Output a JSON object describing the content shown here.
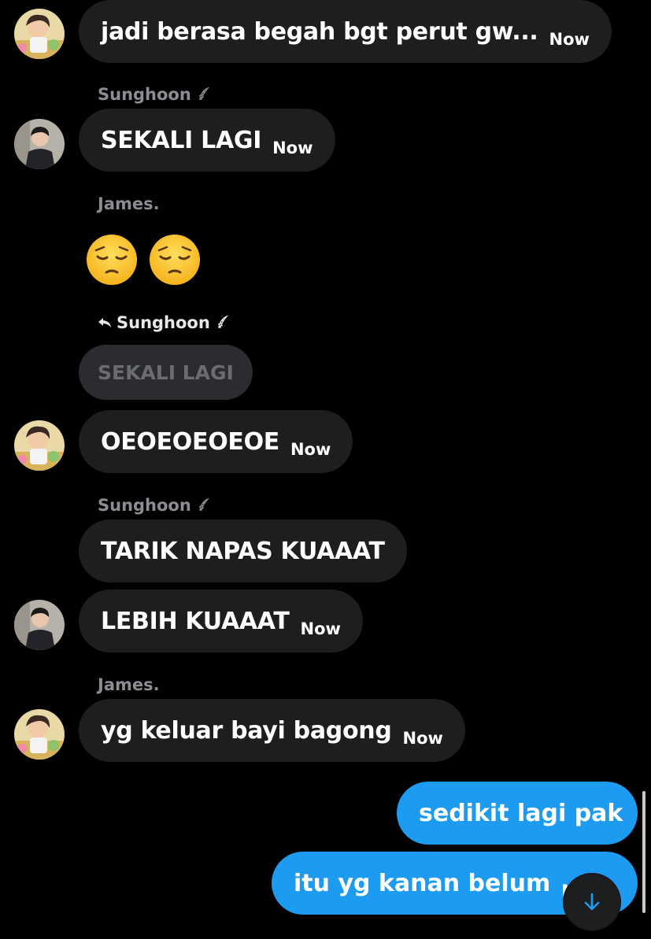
{
  "colors": {
    "background": "#000000",
    "incoming_bubble": "#1d1e20",
    "outgoing_bubble": "#1d9bf0",
    "sender_name": "#8b8d92",
    "quoted_text": "#6a6c71"
  },
  "messages": [
    {
      "text": "jadi berasa begah bgt perut gw...",
      "time": "Now"
    },
    {
      "sender": "Sunghoon",
      "text": "SEKALI LAGI",
      "time": "Now"
    },
    {
      "sender": "James.",
      "emojis": [
        "pensive-face-emoji",
        "pensive-face-emoji"
      ]
    },
    {
      "reply_to": "Sunghoon",
      "quoted": "SEKALI LAGI",
      "text": "OEOEOEOEOE",
      "time": "Now"
    },
    {
      "sender": "Sunghoon",
      "text": "TARIK NAPAS KUAAAT"
    },
    {
      "text": "LEBIH KUAAAT",
      "time": "Now"
    },
    {
      "sender": "James.",
      "text": "yg keluar bayi bagong",
      "time": "Now"
    }
  ],
  "outgoing": [
    {
      "text": "sedikit lagi pak"
    },
    {
      "text": "itu yg kanan belum",
      "time": "Now"
    }
  ],
  "icons": {
    "verified_badge": "feather-badge-icon",
    "reply": "reply-arrow-icon",
    "scroll_down": "arrow-down-icon"
  }
}
